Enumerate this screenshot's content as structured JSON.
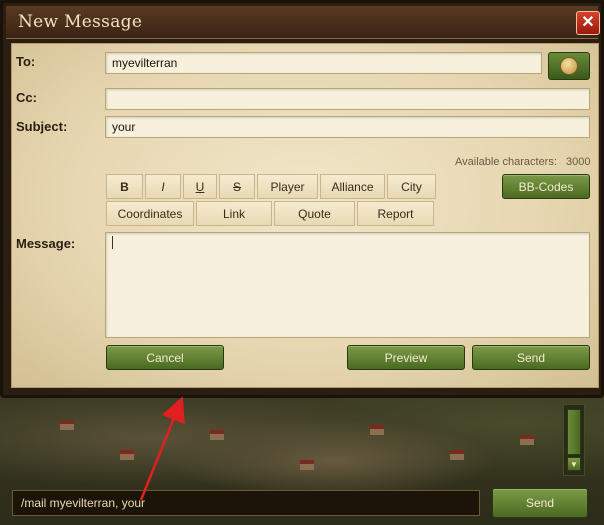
{
  "dialog": {
    "title": "New Message",
    "close_label": "✕"
  },
  "form": {
    "to_label": "To:",
    "to_value": "myevilterran",
    "cc_label": "Cc:",
    "cc_value": "",
    "subject_label": "Subject:",
    "subject_value": "your",
    "available_label": "Available characters:",
    "available_count": "3000",
    "message_label": "Message:",
    "message_value": ""
  },
  "toolbar": {
    "row1": [
      "B",
      "I",
      "U",
      "S",
      "Player",
      "Alliance",
      "City"
    ],
    "row2": [
      "Coordinates",
      "Link",
      "Quote",
      "Report"
    ],
    "bbcodes_label": "BB-Codes"
  },
  "actions": {
    "cancel_label": "Cancel",
    "preview_label": "Preview",
    "send_label": "Send"
  },
  "chat": {
    "input_value": "/mail myevilterran, your",
    "send_label": "Send"
  },
  "colors": {
    "annotation_arrow": "#e02020",
    "button_green": "#5a7a2c",
    "panel_bg": "#ede0c0"
  },
  "icons": {
    "address_book": "address-book-icon",
    "close": "close-icon",
    "scroll_down": "chevron-down-icon"
  }
}
